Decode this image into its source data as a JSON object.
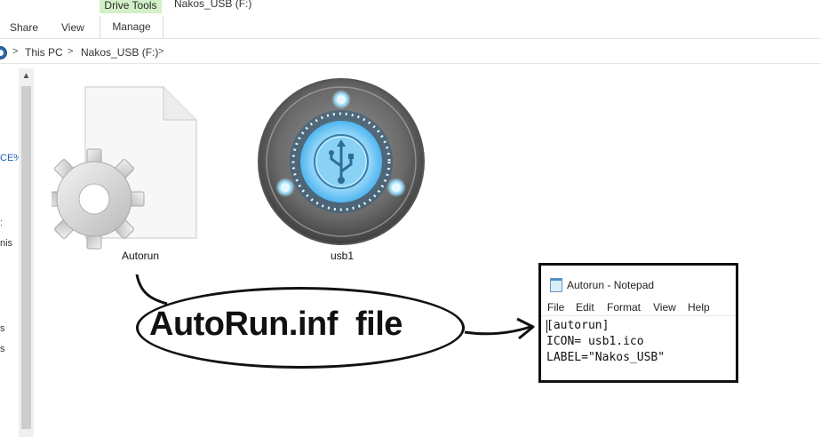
{
  "window": {
    "title": "Nakos_USB (F:)"
  },
  "ribbon": {
    "contextual_group": "Drive Tools",
    "tabs": [
      {
        "label": "Share"
      },
      {
        "label": "View"
      },
      {
        "label": "Manage"
      }
    ]
  },
  "address": {
    "breadcrumb": [
      {
        "label": "This PC"
      },
      {
        "label": "Nakos_USB (F:)"
      }
    ],
    "separator": ">"
  },
  "nav_pane": {
    "partial_items": [
      "CE%",
      "nis",
      "s",
      "s"
    ]
  },
  "files": [
    {
      "name": "Autorun",
      "icon": "settings-file-icon"
    },
    {
      "name": "usb1",
      "icon": "usb-disc-icon"
    }
  ],
  "annotation": {
    "label": "AutoRun.inf  file"
  },
  "notepad": {
    "title": "Autorun - Notepad",
    "menu": [
      "File",
      "Edit",
      "Format",
      "View",
      "Help"
    ],
    "lines": [
      "[autorun]",
      "ICON= usb1.ico",
      "LABEL=\"Nakos_USB\""
    ]
  },
  "colors": {
    "drive_tools": "#d3f0c7",
    "link": "#1a5fb4",
    "usb_glow": "#7fd4ff"
  }
}
